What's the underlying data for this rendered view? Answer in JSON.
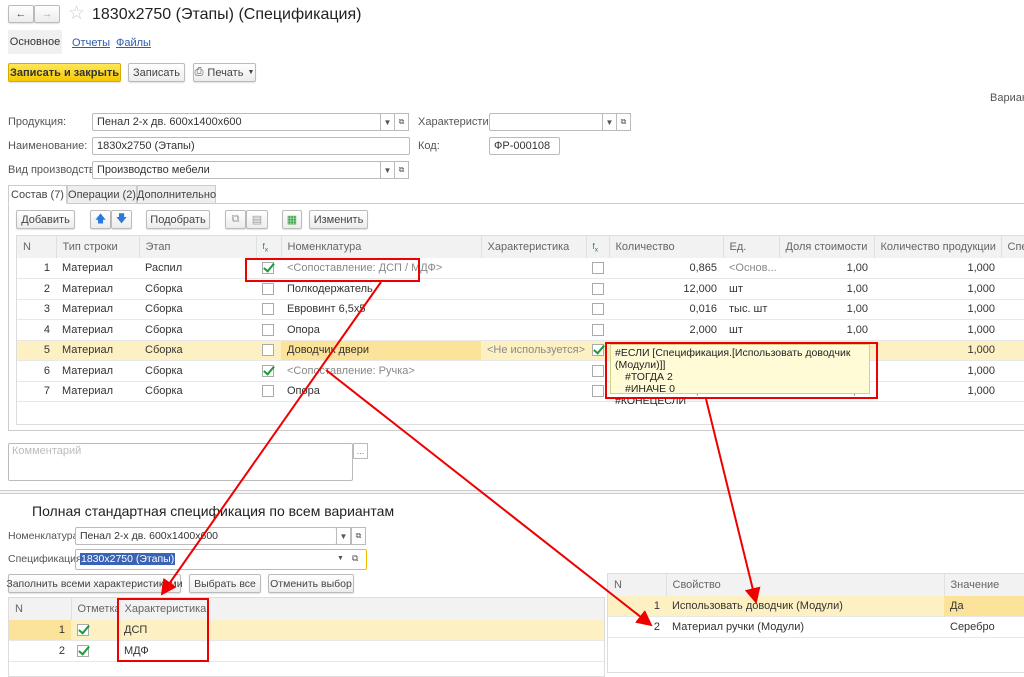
{
  "header": {
    "title": "1830x2750 (Этапы) (Спецификация)",
    "back_icon": "arrow-left",
    "forward_icon": "arrow-right",
    "favorite_icon": "star"
  },
  "nav_tabs": [
    {
      "label": "Основное"
    },
    {
      "label": "Отчеты"
    },
    {
      "label": "Файлы"
    }
  ],
  "toolbar": {
    "save_close": "Записать и закрыть",
    "save": "Записать",
    "print": "Печать"
  },
  "variant_label": "Вариант",
  "fields": {
    "product_label": "Продукция:",
    "product_value": "Пенал 2-х дв. 600x1400x600",
    "char_label": "Характеристика:",
    "char_value": "",
    "name_label": "Наименование:",
    "name_value": "1830x2750 (Этапы)",
    "code_label": "Код:",
    "code_value": "ФР-000108",
    "prod_type_label": "Вид производства:",
    "prod_type_value": "Производство мебели"
  },
  "tabs": [
    {
      "label": "Состав (7)"
    },
    {
      "label": "Операции (2)"
    },
    {
      "label": "Дополнительно"
    }
  ],
  "table_toolbar": {
    "add": "Добавить",
    "pick": "Подобрать",
    "change": "Изменить"
  },
  "columns": [
    "N",
    "Тип строки",
    "Этап",
    "fx",
    "Номенклатура",
    "Характеристика",
    "fx",
    "Количество",
    "Ед.",
    "Доля стоимости",
    "Количество продукции",
    "Спец"
  ],
  "rows": [
    {
      "n": "1",
      "type": "Материал",
      "stage": "Распил",
      "f1": true,
      "nom": "<Сопоставление: ДСП / МДФ>",
      "nom_gray": true,
      "char": "",
      "f2": false,
      "qty": "0,865",
      "unit": "<Основ...",
      "share": "1,00",
      "prod_qty": "1,000"
    },
    {
      "n": "2",
      "type": "Материал",
      "stage": "Сборка",
      "f1": false,
      "nom": "Полкодержатель",
      "char": "",
      "f2": false,
      "qty": "12,000",
      "unit": "шт",
      "share": "1,00",
      "prod_qty": "1,000"
    },
    {
      "n": "3",
      "type": "Материал",
      "stage": "Сборка",
      "f1": false,
      "nom": "Евровинт 6,5x5",
      "char": "",
      "f2": false,
      "qty": "0,016",
      "unit": "тыс. шт",
      "share": "1,00",
      "prod_qty": "1,000"
    },
    {
      "n": "4",
      "type": "Материал",
      "stage": "Сборка",
      "f1": false,
      "nom": "Опора",
      "char": "",
      "f2": false,
      "qty": "2,000",
      "unit": "шт",
      "share": "1,00",
      "prod_qty": "1,000"
    },
    {
      "n": "5",
      "type": "Материал",
      "stage": "Сборка",
      "f1": false,
      "nom": "Доводчик двери",
      "char": "<Не используется>",
      "f2": true,
      "qty": "",
      "unit": "",
      "share": "",
      "prod_qty": "1,000"
    },
    {
      "n": "6",
      "type": "Материал",
      "stage": "Сборка",
      "f1": true,
      "nom": "<Сопоставление: Ручка>",
      "nom_gray": true,
      "char": "",
      "f2": false,
      "qty": "",
      "unit": "",
      "share": "",
      "prod_qty": "1,000"
    },
    {
      "n": "7",
      "type": "Материал",
      "stage": "Сборка",
      "f1": false,
      "nom": "Опора",
      "char": "",
      "f2": false,
      "qty": "4,000",
      "unit": "шт",
      "share": "1,00",
      "prod_qty": "1,000"
    }
  ],
  "tooltip": [
    "#ЕСЛИ [Спецификация.[Использовать доводчик (Модули)]]",
    "#ТОГДА 2",
    "#ИНАЧЕ 0",
    "#КОНЕЦЕСЛИ"
  ],
  "comment_placeholder": "Комментарий",
  "bottom": {
    "title": "Полная стандартная спецификация по всем вариантам",
    "nom_label": "Номенклатура:",
    "nom_value": "Пенал 2-х дв. 600x1400x600",
    "spec_label": "Спецификация:",
    "spec_value": "1830x2750 (Этапы)",
    "fill_all": "Заполнить всеми характеристиками",
    "select_all": "Выбрать все",
    "cancel_select": "Отменить выбор",
    "left_columns": [
      "N",
      "Отметка",
      "Характеристика"
    ],
    "left_rows": [
      {
        "n": "1",
        "mark": true,
        "char": "ДСП"
      },
      {
        "n": "2",
        "mark": true,
        "char": "МДФ"
      }
    ],
    "right_columns": [
      "N",
      "Свойство",
      "Значение"
    ],
    "right_rows": [
      {
        "n": "1",
        "prop": "Использовать доводчик (Модули)",
        "value": "Да"
      },
      {
        "n": "2",
        "prop": "Материал ручки (Модули)",
        "value": "Серебро"
      }
    ]
  },
  "colors": {
    "accent_yellow": "#f5c800",
    "annotation_red": "#e00000",
    "selected_row": "#fdf1c4"
  }
}
